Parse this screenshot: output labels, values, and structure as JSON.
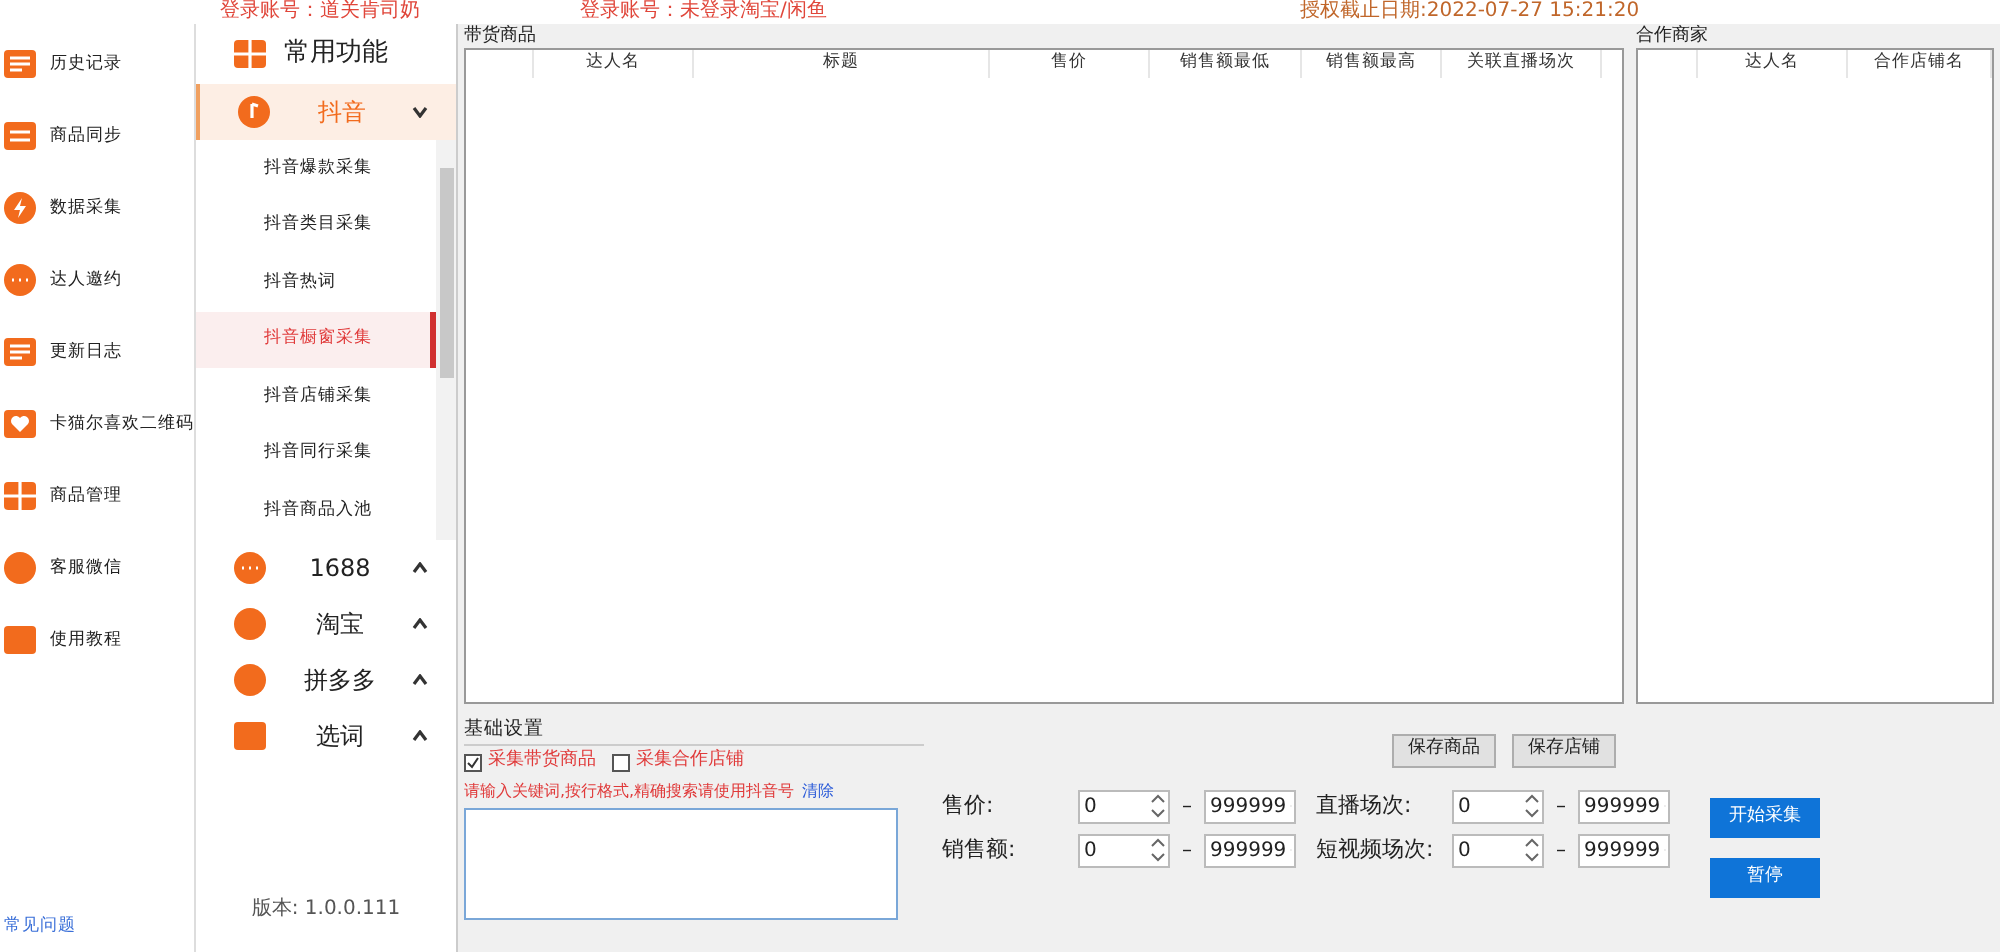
{
  "header": {
    "texts": [
      "登录账号：道关肯司奶",
      "登录账号：未登录淘宝/闲鱼",
      "授权截止日期:2022-07-27 15:21:20"
    ]
  },
  "sidebar": {
    "items": [
      {
        "label": "历史记录"
      },
      {
        "label": "商品同步"
      },
      {
        "label": "数据采集"
      },
      {
        "label": "达人邀约"
      },
      {
        "label": "更新日志"
      },
      {
        "label": "卡猫尔喜欢二维码"
      },
      {
        "label": "商品管理"
      },
      {
        "label": "客服微信"
      },
      {
        "label": "使用教程"
      }
    ],
    "footer_link": "常见问题"
  },
  "menu": {
    "title": "常用功能",
    "groups": [
      {
        "label": "抖音",
        "expanded": true,
        "children": [
          {
            "label": "抖音爆款采集",
            "selected": false
          },
          {
            "label": "抖音类目采集",
            "selected": false
          },
          {
            "label": "抖音热词",
            "selected": false
          },
          {
            "label": "抖音橱窗采集",
            "selected": true
          },
          {
            "label": "抖音店铺采集",
            "selected": false
          },
          {
            "label": "抖音同行采集",
            "selected": false
          },
          {
            "label": "抖音商品入池",
            "selected": false
          }
        ]
      },
      {
        "label": "1688",
        "expanded": false
      },
      {
        "label": "淘宝",
        "expanded": false
      },
      {
        "label": "拼多多",
        "expanded": false
      },
      {
        "label": "选词",
        "expanded": false
      }
    ],
    "version": "版本: 1.0.0.111"
  },
  "goods_table": {
    "title": "带货商品",
    "columns": [
      "",
      "达人名",
      "标题",
      "售价",
      "销售额最低",
      "销售额最高",
      "关联直播场次"
    ]
  },
  "partner_table": {
    "title": "合作商家",
    "columns": [
      "",
      "达人名",
      "合作店铺名"
    ]
  },
  "settings": {
    "title": "基础设置",
    "checkboxes": [
      {
        "label": "采集带货商品",
        "checked": true
      },
      {
        "label": "采集合作店铺",
        "checked": false
      }
    ],
    "hint": "请输入关键词,按行格式,精确搜索请使用抖音号",
    "clear_link": "清除",
    "ranges": [
      {
        "label": "售价:",
        "min": "0",
        "separator": "–",
        "max": "999999"
      },
      {
        "label": "销售额:",
        "min": "0",
        "separator": "–",
        "max": "999999"
      },
      {
        "label": "直播场次:",
        "min": "0",
        "separator": "–",
        "max": "999999"
      },
      {
        "label": "短视频场次:",
        "min": "0",
        "separator": "–",
        "max": "999999"
      }
    ],
    "save_buttons": [
      "保存商品",
      "保存店铺"
    ],
    "action_buttons": [
      "开始采集",
      "暂停"
    ]
  }
}
